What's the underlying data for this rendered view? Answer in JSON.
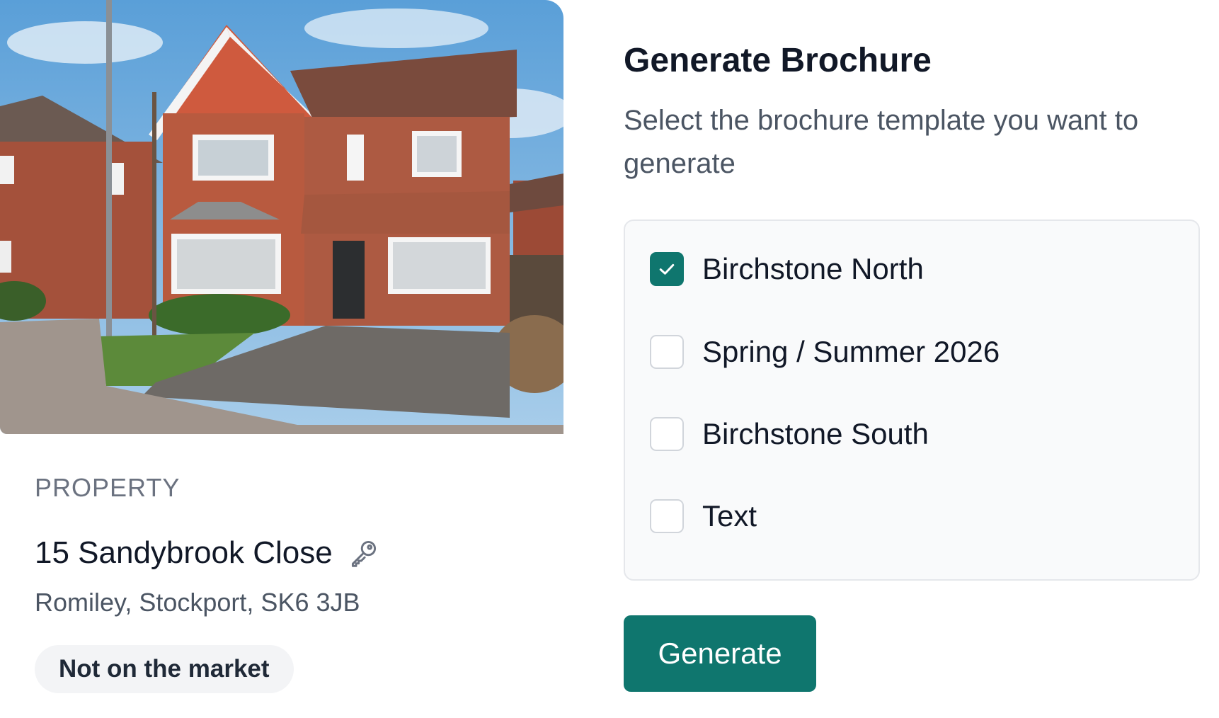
{
  "property": {
    "section_label": "PROPERTY",
    "address": "15 Sandybrook Close",
    "locality": "Romiley, Stockport, SK6 3JB",
    "status": "Not on the market",
    "key_icon": "key-icon"
  },
  "brochure": {
    "title": "Generate Brochure",
    "subtitle": "Select the brochure template you want to generate",
    "options": [
      {
        "label": "Birchstone North",
        "checked": true
      },
      {
        "label": "Spring / Summer 2026",
        "checked": false
      },
      {
        "label": "Birchstone South",
        "checked": false
      },
      {
        "label": "Text",
        "checked": false
      }
    ],
    "generate_label": "Generate"
  },
  "colors": {
    "accent": "#0f766e",
    "badge_bg": "#f3f4f6",
    "panel_bg": "#f9fafb"
  }
}
